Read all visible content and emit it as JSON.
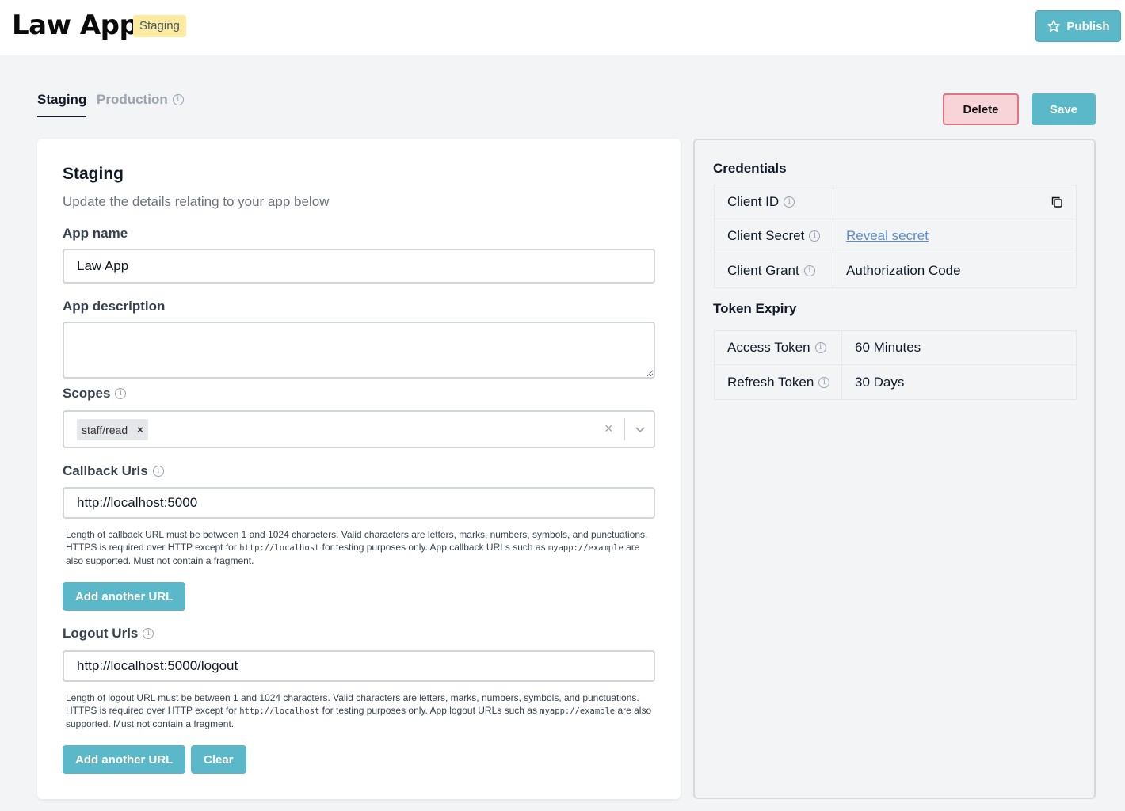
{
  "header": {
    "app_title": "Law App",
    "env_badge": "Staging",
    "publish_label": "Publish"
  },
  "tabs": [
    {
      "label": "Staging",
      "active": true
    },
    {
      "label": "Production",
      "active": false
    }
  ],
  "actions": {
    "delete_label": "Delete",
    "save_label": "Save"
  },
  "form": {
    "title": "Staging",
    "subtitle": "Update the details relating to your app below",
    "app_name": {
      "label": "App name",
      "value": "Law App"
    },
    "app_description": {
      "label": "App description",
      "value": ""
    },
    "scopes": {
      "label": "Scopes",
      "chips": [
        "staff/read"
      ],
      "chip_remove": "×",
      "clear_icon": "×"
    },
    "callback": {
      "label": "Callback Urls",
      "value": "http://localhost:5000",
      "help_pre": "Length of callback URL must be between 1 and 1024 characters. Valid characters are letters, marks, numbers, symbols, and punctuations. HTTPS is required over HTTP except for ",
      "help_code1": "http://localhost",
      "help_mid": " for testing purposes only. App callback URLs such as ",
      "help_code2": "myapp://example",
      "help_post": " are also supported. Must not contain a fragment.",
      "add_label": "Add another URL"
    },
    "logout": {
      "label": "Logout Urls",
      "value": "http://localhost:5000/logout",
      "help_pre": "Length of logout URL must be between 1 and 1024 characters. Valid characters are letters, marks, numbers, symbols, and punctuations. HTTPS is required over HTTP except for ",
      "help_code1": "http://localhost",
      "help_mid": " for testing purposes only. App logout URLs such as ",
      "help_code2": "myapp://example",
      "help_post": " are also supported. Must not contain a fragment.",
      "add_label": "Add another URL",
      "clear_label": "Clear"
    }
  },
  "credentials": {
    "title": "Credentials",
    "client_id": {
      "key": "Client ID",
      "value": ""
    },
    "client_secret": {
      "key": "Client Secret",
      "link": "Reveal secret"
    },
    "client_grant": {
      "key": "Client Grant",
      "value": "Authorization Code"
    }
  },
  "token_expiry": {
    "title": "Token Expiry",
    "access": {
      "key": "Access Token",
      "value": "60 Minutes"
    },
    "refresh": {
      "key": "Refresh Token",
      "value": "30 Days"
    }
  },
  "colors": {
    "accent": "#5bb8c9",
    "danger_bg": "#f8d4d8",
    "danger_border": "#e0737f",
    "badge_bg": "#fbeba0",
    "link": "#5b8ad6"
  },
  "icons": {
    "publish": "star-outline-icon",
    "info": "info-circle-icon",
    "copy": "copy-icon",
    "chevron": "chevron-down-icon"
  }
}
